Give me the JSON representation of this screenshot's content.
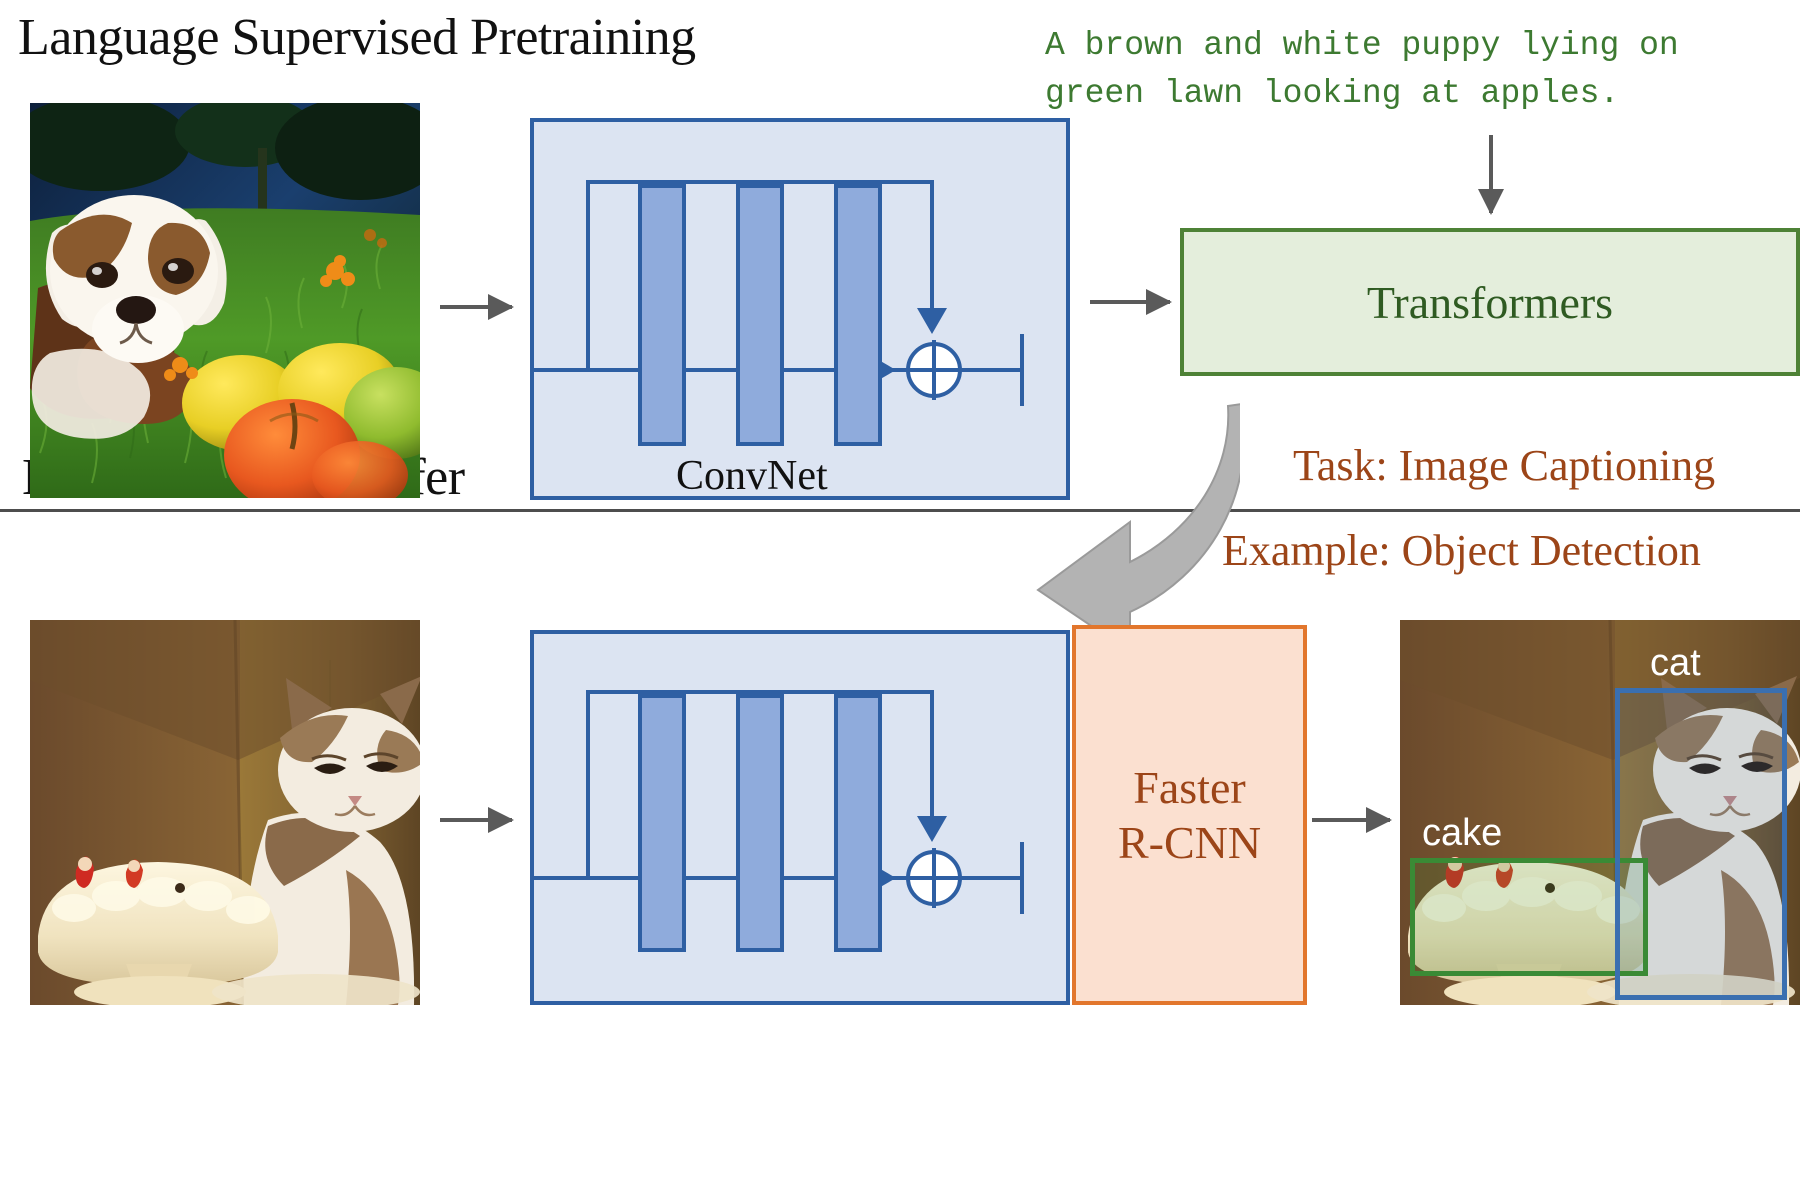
{
  "figure": {
    "domain": "diagram",
    "sections": {
      "pretraining_title": "Language Supervised Pretraining",
      "downstream_title": "Downstream Transfer"
    },
    "caption": {
      "text": "A brown and white puppy lying on\ngreen lawn looking at apples.",
      "color": "#3d7a31"
    },
    "blocks": {
      "convnet_label": "ConvNet",
      "transformers_label": "Transformers",
      "frcnn_label": "Faster\nR-CNN"
    },
    "annotations": {
      "task": "Task: Image Captioning",
      "example": "Example: Object Detection"
    },
    "detection": {
      "labels": [
        {
          "name": "cake",
          "color": "#3a8a35"
        },
        {
          "name": "cat",
          "color": "#3a6fb0"
        }
      ]
    },
    "colors": {
      "convnet_fill": "#dce4f2",
      "convnet_stroke": "#2e5fa3",
      "conv_bar_fill": "#8fabdc",
      "transformer_fill": "#e4eedc",
      "transformer_stroke": "#4e8236",
      "transformer_text": "#2f5b22",
      "frcnn_fill": "#fbe0d0",
      "frcnn_stroke": "#e2762c",
      "brown_text": "#9c4518",
      "arrow_gray": "#5a5a5a",
      "caption_green": "#3d7a31",
      "transfer_arrow": "#b0b0b0"
    },
    "images": {
      "dog_photo_alt": "brown and white puppy lying on green lawn with apples",
      "cat_photo_alt": "cat sitting behind a white frosted cake indoors",
      "detection_photo_alt": "cat and cake with detection bounding boxes"
    }
  }
}
